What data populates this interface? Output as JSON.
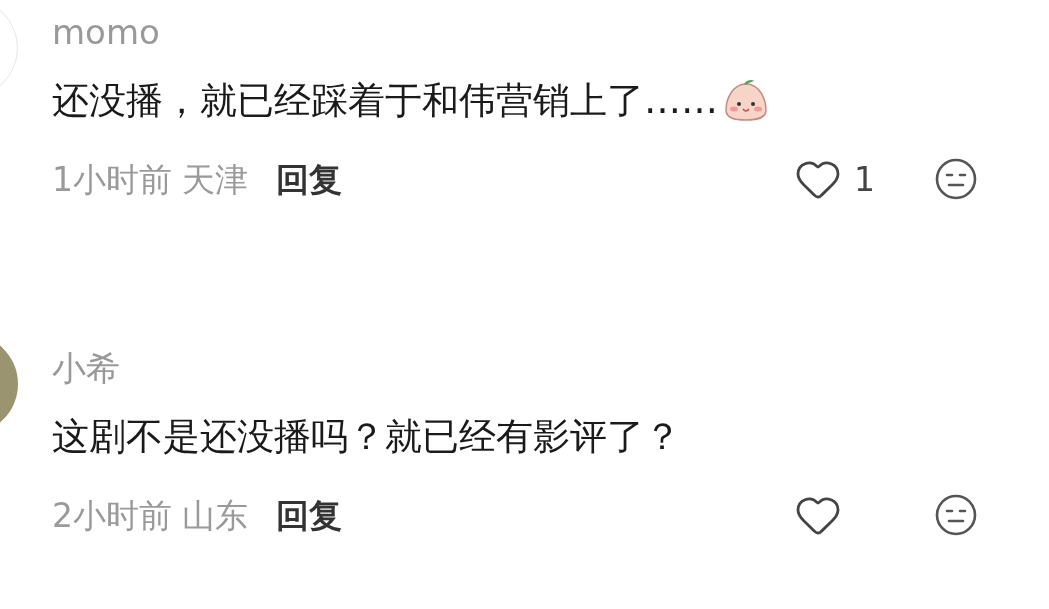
{
  "comments": [
    {
      "avatar": {
        "kind": "blank"
      },
      "username": "momo",
      "text": "还没播，就已经踩着于和伟营销上了……",
      "emoji": true,
      "time": "1小时前",
      "location": "天津",
      "reply_label": "回复",
      "like_count": "1"
    },
    {
      "avatar": {
        "kind": "photo"
      },
      "username": "小希",
      "text": "这剧不是还没播吗？就已经有影评了？",
      "emoji": false,
      "time": "2小时前",
      "location": "山东",
      "reply_label": "回复"
    }
  ]
}
